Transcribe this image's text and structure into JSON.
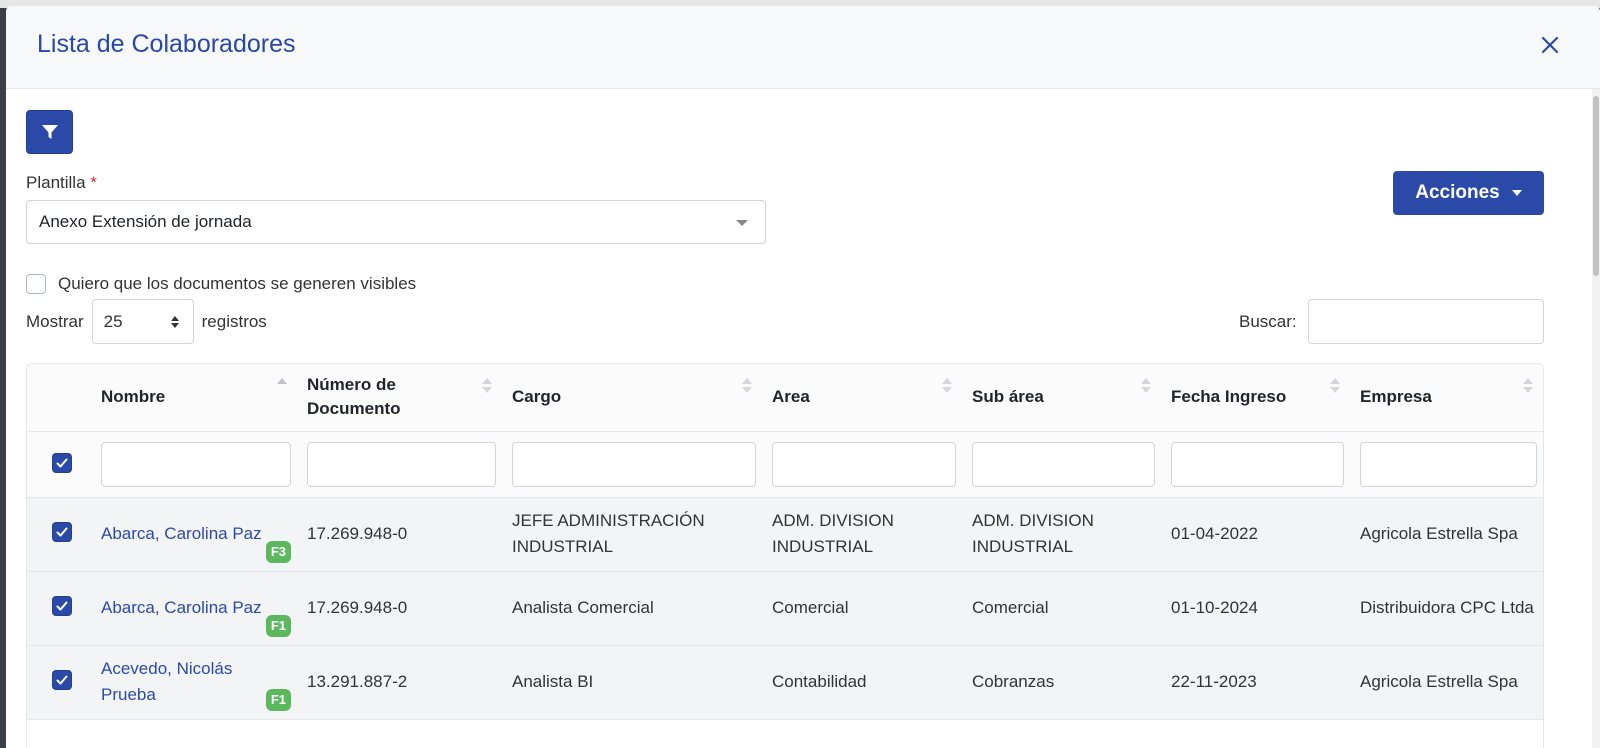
{
  "modal": {
    "title": "Lista de Colaboradores",
    "close_glyph": "×"
  },
  "form": {
    "plantilla_label": "Plantilla",
    "required_mark": "*",
    "plantilla_value": "Anexo Extensión de jornada",
    "acciones_label": "Acciones",
    "visible_checkbox_label": "Quiero que los documentos se generen visibles",
    "visible_checked": false,
    "mostrar_label": "Mostrar",
    "page_size": "25",
    "registros_label": "registros",
    "buscar_label": "Buscar:",
    "buscar_value": ""
  },
  "table": {
    "columns": [
      {
        "key": "nombre",
        "label": "Nombre"
      },
      {
        "key": "documento",
        "label": "Número de Documento"
      },
      {
        "key": "cargo",
        "label": "Cargo"
      },
      {
        "key": "area",
        "label": "Area"
      },
      {
        "key": "subarea",
        "label": "Sub área"
      },
      {
        "key": "fecha",
        "label": "Fecha Ingreso"
      },
      {
        "key": "empresa",
        "label": "Empresa"
      }
    ],
    "rows": [
      {
        "nombre": "Abarca, Carolina Paz",
        "badge": "F3",
        "documento": "17.269.948-0",
        "cargo": "JEFE ADMINISTRACIÓN INDUSTRIAL",
        "area": "ADM. DIVISION INDUSTRIAL",
        "subarea": "ADM. DIVISION INDUSTRIAL",
        "fecha": "01-04-2022",
        "empresa": "Agricola Estrella Spa",
        "checked": true
      },
      {
        "nombre": "Abarca, Carolina Paz",
        "badge": "F1",
        "documento": "17.269.948-0",
        "cargo": "Analista Comercial",
        "area": "Comercial",
        "subarea": "Comercial",
        "fecha": "01-10-2024",
        "empresa": "Distribuidora CPC Ltda",
        "checked": true
      },
      {
        "nombre": "Acevedo, Nicolás Prueba",
        "badge": "F1",
        "documento": "13.291.887-2",
        "cargo": "Analista BI",
        "area": "Contabilidad",
        "subarea": "Cobranzas",
        "fecha": "22-11-2023",
        "empresa": "Agricola Estrella Spa",
        "checked": true
      }
    ]
  },
  "icons": {
    "filter": "filter-icon",
    "close": "close-icon",
    "check": "check-icon"
  },
  "colors": {
    "primary": "#2b4aa8",
    "badge_green": "#5cb85c",
    "required_red": "#d9342b"
  }
}
